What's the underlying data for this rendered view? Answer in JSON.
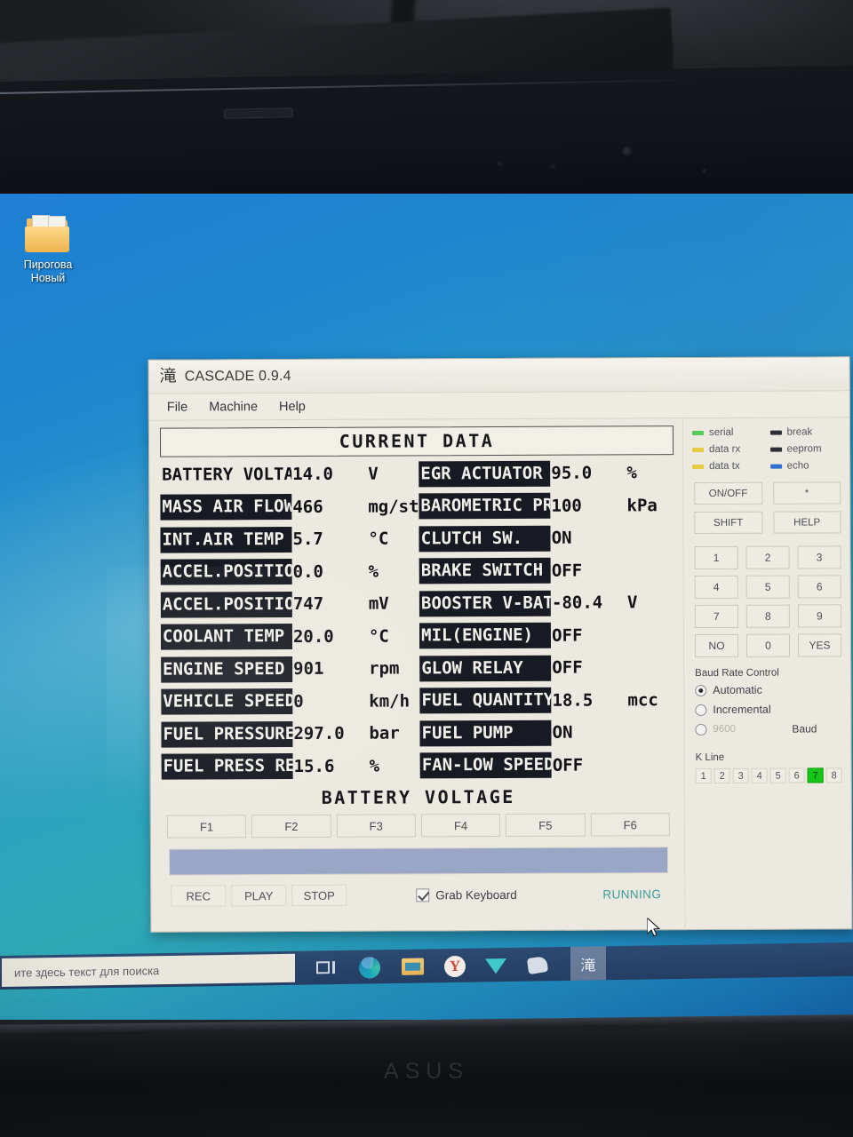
{
  "desktop": {
    "icon": {
      "name": "folder-icon",
      "label_line1": "Пирогова",
      "label_line2": "Новый"
    }
  },
  "window": {
    "app_glyph": "滝",
    "title": "CASCADE 0.9.4",
    "menu": [
      "File",
      "Machine",
      "Help"
    ]
  },
  "data_panel": {
    "header": "CURRENT  DATA",
    "left_rows": [
      {
        "label": "BATTERY VOLTAGE",
        "value": "14.0",
        "unit": "V",
        "inverted": false
      },
      {
        "label": "MASS AIR FLOW",
        "value": "466",
        "unit": "mg/st",
        "inverted": true
      },
      {
        "label": "INT.AIR TEMP",
        "value": "5.7",
        "unit": "°C",
        "inverted": true
      },
      {
        "label": "ACCEL.POSITION",
        "value": "0.0",
        "unit": "%",
        "inverted": true
      },
      {
        "label": "ACCEL.POSITION",
        "value": "747",
        "unit": "mV",
        "inverted": true
      },
      {
        "label": "COOLANT TEMP",
        "value": "20.0",
        "unit": "°C",
        "inverted": true
      },
      {
        "label": "ENGINE SPEED",
        "value": "901",
        "unit": "rpm",
        "inverted": true
      },
      {
        "label": "VEHICLE SPEED",
        "value": "0",
        "unit": "km/h",
        "inverted": true
      },
      {
        "label": "FUEL PRESSURE",
        "value": "297.0",
        "unit": "bar",
        "inverted": true
      },
      {
        "label": "FUEL PRESS REG",
        "value": "15.6",
        "unit": "%",
        "inverted": true
      }
    ],
    "right_rows": [
      {
        "label": "EGR ACTUATOR",
        "value": "95.0",
        "unit": "%",
        "inverted": true
      },
      {
        "label": "BAROMETRIC PRES",
        "value": "100",
        "unit": "kPa",
        "inverted": true
      },
      {
        "label": "CLUTCH SW.",
        "value": "ON",
        "unit": "",
        "inverted": true
      },
      {
        "label": "BRAKE SWITCH",
        "value": "OFF",
        "unit": "",
        "inverted": true
      },
      {
        "label": "BOOSTER V-BAT",
        "value": "-80.4",
        "unit": "V",
        "inverted": true
      },
      {
        "label": "MIL(ENGINE)",
        "value": "OFF",
        "unit": "",
        "inverted": true
      },
      {
        "label": "GLOW RELAY",
        "value": "OFF",
        "unit": "",
        "inverted": true
      },
      {
        "label": "FUEL QUANTITY",
        "value": "18.5",
        "unit": "mcc",
        "inverted": true
      },
      {
        "label": "FUEL PUMP",
        "value": "ON",
        "unit": "",
        "inverted": true
      },
      {
        "label": "FAN-LOW SPEED",
        "value": "OFF",
        "unit": "",
        "inverted": true
      }
    ],
    "graph_title": "BATTERY  VOLTAGE",
    "function_keys": [
      "F1",
      "F2",
      "F3",
      "F4",
      "F5",
      "F6"
    ],
    "progress_percent": 100,
    "transport": [
      "REC",
      "PLAY",
      "STOP"
    ],
    "grab_keyboard": {
      "label": "Grab Keyboard",
      "checked": true
    },
    "status": "RUNNING"
  },
  "sidebar": {
    "leds": [
      {
        "label": "serial",
        "color": "#55cc55"
      },
      {
        "label": "break",
        "color": "#2d2f33"
      },
      {
        "label": "data rx",
        "color": "#e8cc44"
      },
      {
        "label": "eeprom",
        "color": "#2d2f33"
      },
      {
        "label": "data tx",
        "color": "#e8cc44"
      },
      {
        "label": "echo",
        "color": "#2f6fd0"
      }
    ],
    "control_rows": [
      [
        "ON/OFF",
        "*"
      ],
      [
        "SHIFT",
        "HELP"
      ]
    ],
    "keypad": [
      "1",
      "2",
      "3",
      "4",
      "5",
      "6",
      "7",
      "8",
      "9",
      "NO",
      "0",
      "YES"
    ],
    "baud": {
      "title": "Baud Rate Control",
      "options": [
        {
          "label": "Automatic",
          "selected": true
        },
        {
          "label": "Incremental",
          "selected": false
        },
        {
          "label": "",
          "selected": false
        }
      ],
      "value": "9600",
      "suffix": "Baud"
    },
    "kline": {
      "title": "K Line",
      "cells": [
        "1",
        "2",
        "3",
        "4",
        "5",
        "6",
        "7",
        "8"
      ],
      "active": "7"
    }
  },
  "taskbar": {
    "search_placeholder": "ите здесь текст для поиска",
    "icons": [
      {
        "name": "task-view-icon"
      },
      {
        "name": "edge-browser-icon"
      },
      {
        "name": "file-explorer-icon"
      },
      {
        "name": "yandex-browser-icon",
        "glyph": "Y"
      },
      {
        "name": "telegram-icon"
      },
      {
        "name": "media-app-icon"
      }
    ],
    "active_app_glyph": "滝"
  },
  "hardware": {
    "brand": "ASUS"
  }
}
